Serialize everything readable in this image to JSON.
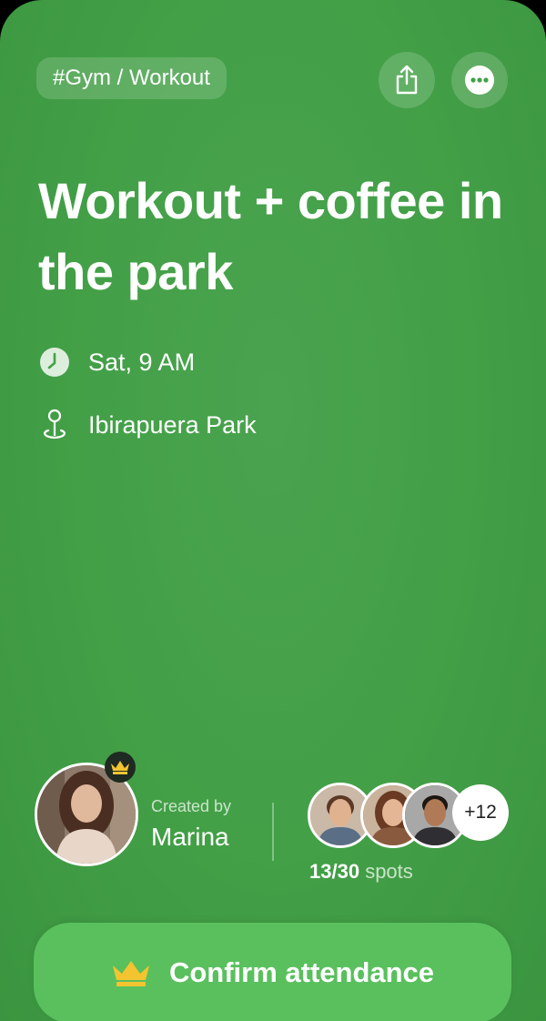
{
  "header": {
    "tag": "#Gym / Workout",
    "share_icon": "share-icon",
    "more_icon": "more-horizontal-icon"
  },
  "event": {
    "title": "Workout + coffee in the park",
    "time": "Sat, 9 AM",
    "location": "Ibirapuera Park"
  },
  "creator": {
    "label": "Created by",
    "name": "Marina",
    "badge_icon": "crown-icon"
  },
  "attendees": {
    "more_count": "+12",
    "taken": "13/30",
    "spots_label": "spots"
  },
  "confirm_button": {
    "label": "Confirm attendance",
    "icon": "crown-icon"
  },
  "colors": {
    "background": "#43a047",
    "button": "#59c05d",
    "crown": "#f4c430"
  }
}
